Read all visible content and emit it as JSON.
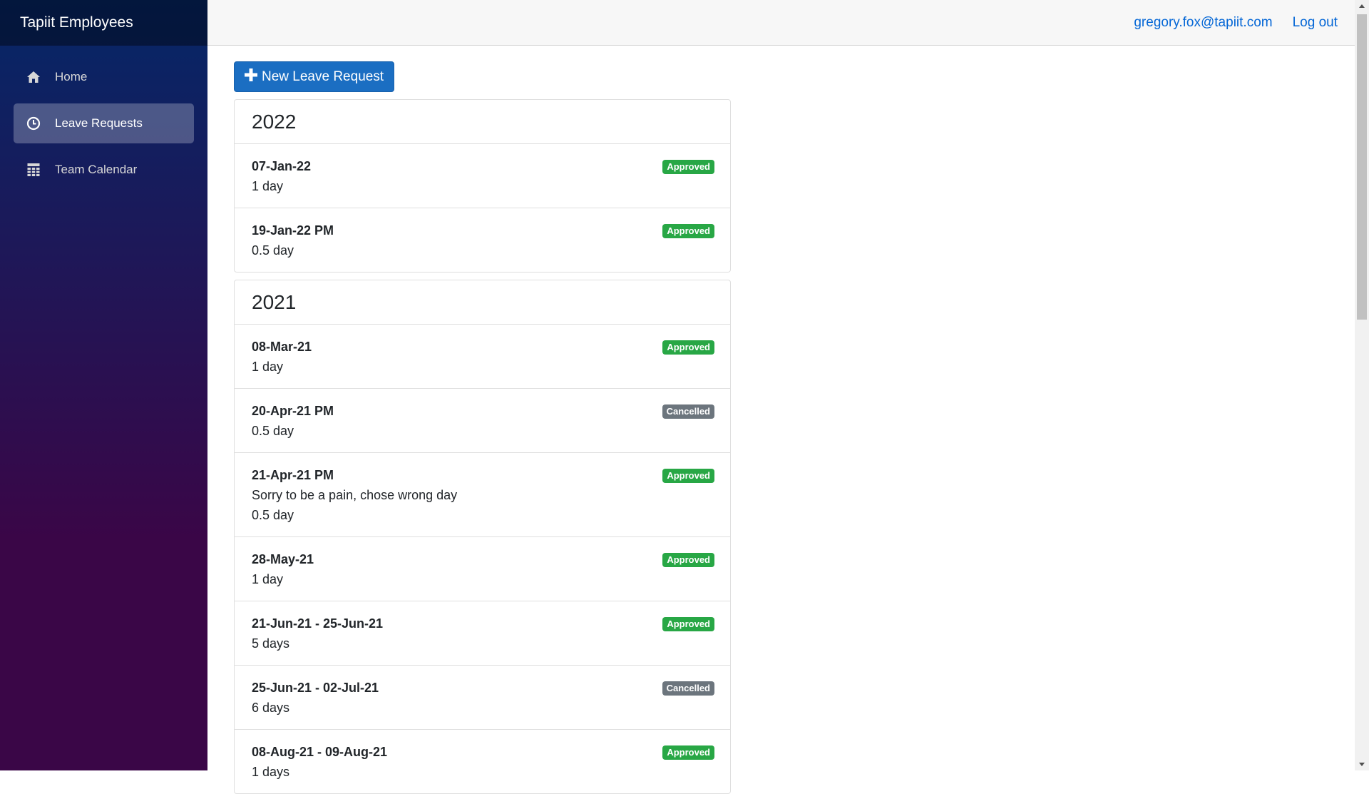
{
  "app": {
    "brand": "Tapiit Employees"
  },
  "sidebar": {
    "items": [
      {
        "label": "Home",
        "icon": "home-icon",
        "active": false
      },
      {
        "label": "Leave Requests",
        "icon": "clock-icon",
        "active": true
      },
      {
        "label": "Team Calendar",
        "icon": "calendar-icon",
        "active": false
      }
    ]
  },
  "topbar": {
    "user_email": "gregory.fox@tapiit.com",
    "logout_label": "Log out"
  },
  "main": {
    "new_request_label": "New Leave Request",
    "years": [
      {
        "year": "2022",
        "requests": [
          {
            "date": "07-Jan-22",
            "duration": "1 day",
            "status": "Approved"
          },
          {
            "date": "19-Jan-22 PM",
            "duration": "0.5 day",
            "status": "Approved"
          }
        ]
      },
      {
        "year": "2021",
        "requests": [
          {
            "date": "08-Mar-21",
            "duration": "1 day",
            "status": "Approved"
          },
          {
            "date": "20-Apr-21 PM",
            "duration": "0.5 day",
            "status": "Cancelled"
          },
          {
            "date": "21-Apr-21 PM",
            "note": "Sorry to be a pain, chose wrong day",
            "duration": "0.5 day",
            "status": "Approved"
          },
          {
            "date": "28-May-21",
            "duration": "1 day",
            "status": "Approved"
          },
          {
            "date": "21-Jun-21 - 25-Jun-21",
            "duration": "5 days",
            "status": "Approved"
          },
          {
            "date": "25-Jun-21 - 02-Jul-21",
            "duration": "6 days",
            "status": "Cancelled"
          },
          {
            "date": "08-Aug-21 - 09-Aug-21",
            "duration": "1 days",
            "status": "Approved"
          }
        ]
      }
    ]
  },
  "colors": {
    "approved": "#28a745",
    "cancelled": "#6c757d",
    "primary": "#1b6ec2",
    "link": "#0366d6"
  }
}
